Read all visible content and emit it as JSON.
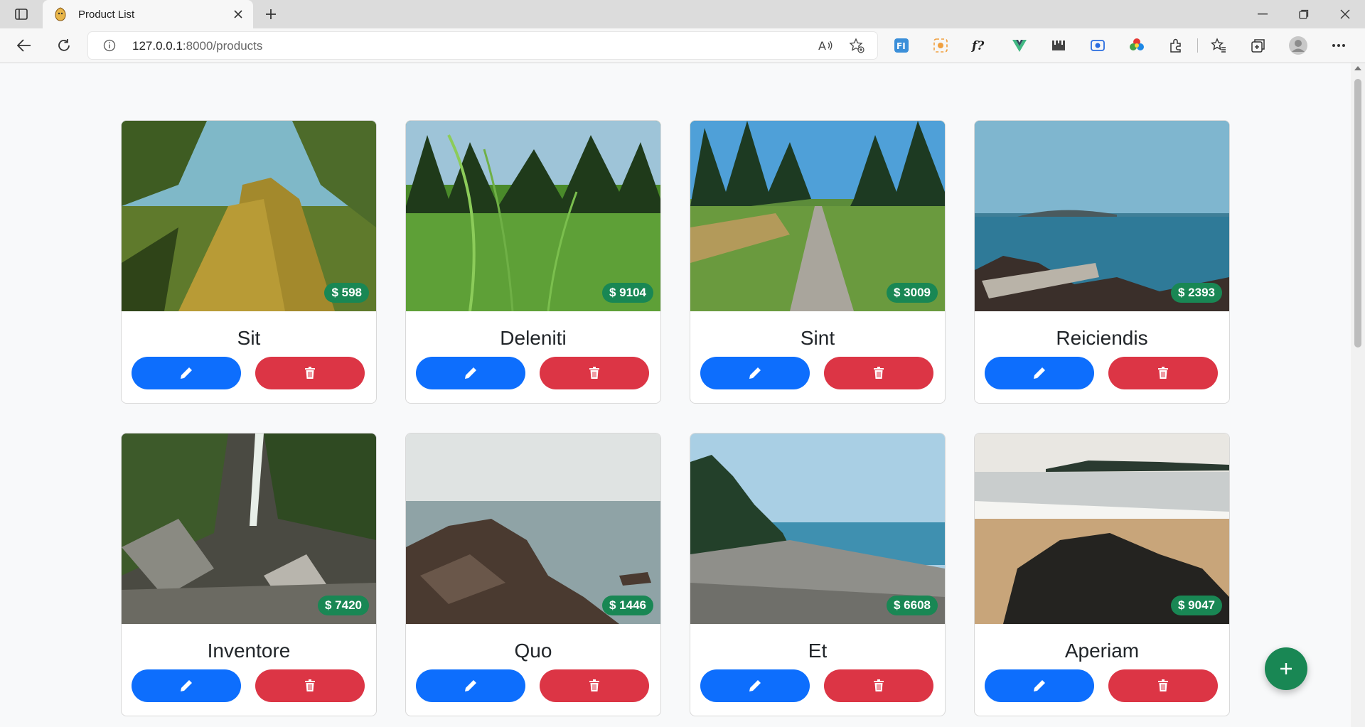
{
  "browser": {
    "tab_title": "Product List",
    "url_host": "127.0.0.1",
    "url_path": ":8000/products"
  },
  "products": [
    {
      "name": "Sit",
      "price": "$ 598"
    },
    {
      "name": "Deleniti",
      "price": "$ 9104"
    },
    {
      "name": "Sint",
      "price": "$ 3009"
    },
    {
      "name": "Reiciendis",
      "price": "$ 2393"
    },
    {
      "name": "Inventore",
      "price": "$ 7420"
    },
    {
      "name": "Quo",
      "price": "$ 1446"
    },
    {
      "name": "Et",
      "price": "$ 6608"
    },
    {
      "name": "Aperiam",
      "price": "$ 9047"
    }
  ],
  "icons": {
    "edit": "pencil-icon",
    "delete": "trash-icon",
    "add": "plus-icon"
  },
  "colors": {
    "edit_button": "#0d6efd",
    "delete_button": "#dc3545",
    "price_badge": "#198754",
    "add_button": "#198754"
  }
}
